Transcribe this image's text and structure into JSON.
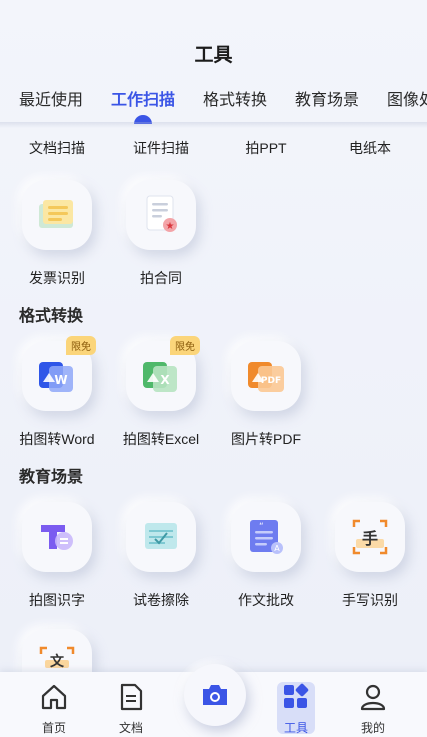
{
  "header": {
    "title": "工具"
  },
  "tabs": [
    {
      "label": "最近使用",
      "active": false
    },
    {
      "label": "工作扫描",
      "active": true
    },
    {
      "label": "格式转换",
      "active": false
    },
    {
      "label": "教育场景",
      "active": false
    },
    {
      "label": "图像处",
      "active": false
    }
  ],
  "partial_row": [
    "文档扫描",
    "证件扫描",
    "拍PPT",
    "电纸本"
  ],
  "work_scan_tools": [
    {
      "label": "发票识别",
      "icon": "invoice-icon"
    },
    {
      "label": "拍合同",
      "icon": "contract-icon"
    }
  ],
  "format_section": {
    "title": "格式转换",
    "tools": [
      {
        "label": "拍图转Word",
        "icon": "photo-to-word-icon",
        "badge": "限免"
      },
      {
        "label": "拍图转Excel",
        "icon": "photo-to-excel-icon",
        "badge": "限免"
      },
      {
        "label": "图片转PDF",
        "icon": "image-to-pdf-icon"
      }
    ]
  },
  "education_section": {
    "title": "教育场景",
    "tools": [
      {
        "label": "拍图识字",
        "icon": "text-recognition-icon"
      },
      {
        "label": "试卷擦除",
        "icon": "exam-erase-icon"
      },
      {
        "label": "作文批改",
        "icon": "essay-correction-icon"
      },
      {
        "label": "手写识别",
        "icon": "handwriting-icon"
      }
    ]
  },
  "bottom_nav": {
    "items": [
      {
        "label": "首页",
        "icon": "home-icon"
      },
      {
        "label": "文档",
        "icon": "document-icon"
      },
      {
        "label": "工具",
        "icon": "tools-icon",
        "active": true
      },
      {
        "label": "我的",
        "icon": "profile-icon"
      }
    ],
    "camera": {
      "icon": "camera-icon"
    }
  },
  "colors": {
    "accent": "#3b55e6",
    "badge": "#fbd57a"
  }
}
